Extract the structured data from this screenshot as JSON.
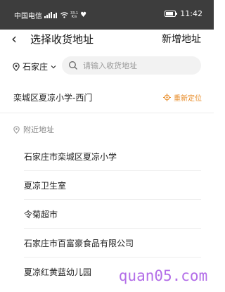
{
  "status_bar": {
    "carrier": "中国电信",
    "speed_top": "33.1",
    "speed_bottom": "K/s",
    "time": "11:42"
  },
  "header": {
    "back_glyph": "‹",
    "title": "选择收货地址",
    "new_address": "新增地址"
  },
  "city": {
    "name": "石家庄"
  },
  "search": {
    "placeholder": "请输入收货地址"
  },
  "current_location": {
    "address": "栾城区夏凉小学-西门",
    "relocate_label": "重新定位"
  },
  "nearby": {
    "heading": "附近地址",
    "items": [
      "石家庄市栾城区夏凉小学",
      "夏凉卫生室",
      "令菊超市",
      "石家庄市百富豪食品有限公司",
      "夏凉红黄蓝幼儿园"
    ]
  },
  "watermark": "quan05.com",
  "colors": {
    "accent": "#e88d2a",
    "status_bar": "#3d3d3d",
    "watermark": "#b36ee8"
  },
  "battery_level": 0.8
}
